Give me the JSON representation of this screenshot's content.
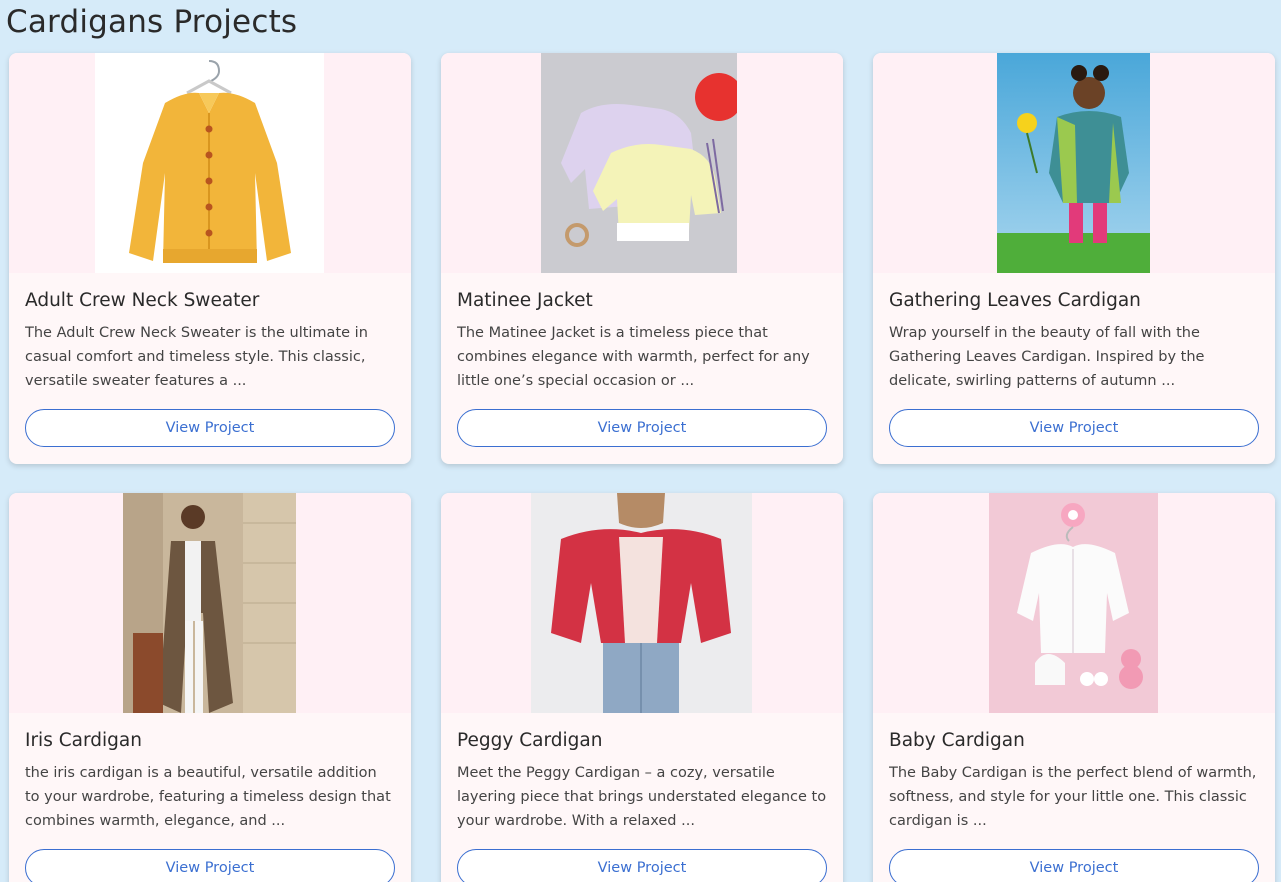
{
  "page": {
    "title": "Cardigans Projects"
  },
  "cards": [
    {
      "title": "Adult Crew Neck Sweater",
      "description": "The Adult Crew Neck Sweater is the ultimate in casual comfort and timeless style. This classic, versatile sweater features a ...",
      "button": "View Project",
      "image": "yellow-crochet-cardigan-on-hanger"
    },
    {
      "title": "Matinee Jacket",
      "description": "The Matinee Jacket is a timeless piece that combines elegance with warmth, perfect for any little one’s special occasion or ...",
      "button": "View Project",
      "image": "lilac-and-lemon-baby-jackets"
    },
    {
      "title": "Gathering Leaves Cardigan",
      "description": "Wrap yourself in the beauty of fall with the Gathering Leaves Cardigan. Inspired by the delicate, swirling patterns of autumn ...",
      "button": "View Project",
      "image": "toddler-in-teal-green-hooded-cardigan"
    },
    {
      "title": "Iris Cardigan",
      "description": "the iris cardigan is a beautiful, versatile addition to your wardrobe, featuring a timeless design that combines warmth, elegance, and ...",
      "button": "View Project",
      "image": "woman-in-long-brown-cardigan"
    },
    {
      "title": "Peggy Cardigan",
      "description": "Meet the Peggy Cardigan – a cozy, versatile layering piece that brings understated elegance to your wardrobe. With a relaxed ...",
      "button": "View Project",
      "image": "woman-in-red-cropped-cardigan"
    },
    {
      "title": "Baby Cardigan",
      "description": "The Baby Cardigan is the perfect blend of warmth, softness, and style for your little one. This classic cardigan is ...",
      "button": "View Project",
      "image": "white-baby-cardigan-set"
    }
  ],
  "colors": {
    "page_background": "#d6ebf9",
    "card_background": "#fff7f8",
    "accent": "#3b6fd1"
  }
}
